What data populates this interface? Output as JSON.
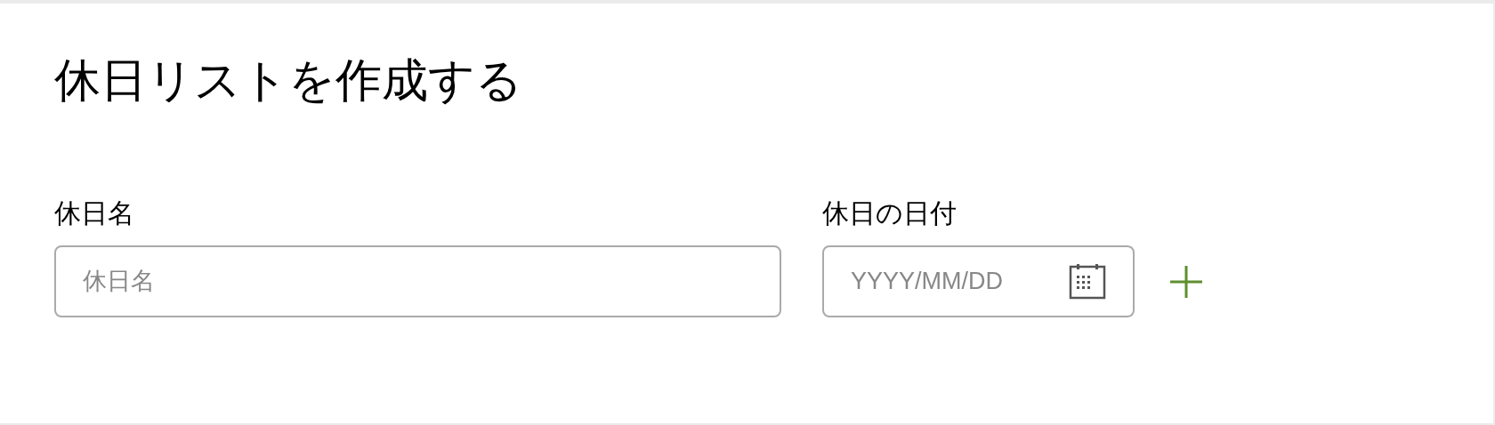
{
  "title": "休日リストを作成する",
  "fields": [
    {
      "kind": "text",
      "label": "休日名",
      "placeholder": "休日名"
    },
    {
      "kind": "date",
      "label": "休日の日付",
      "placeholder": "YYYY/MM/DD"
    }
  ]
}
